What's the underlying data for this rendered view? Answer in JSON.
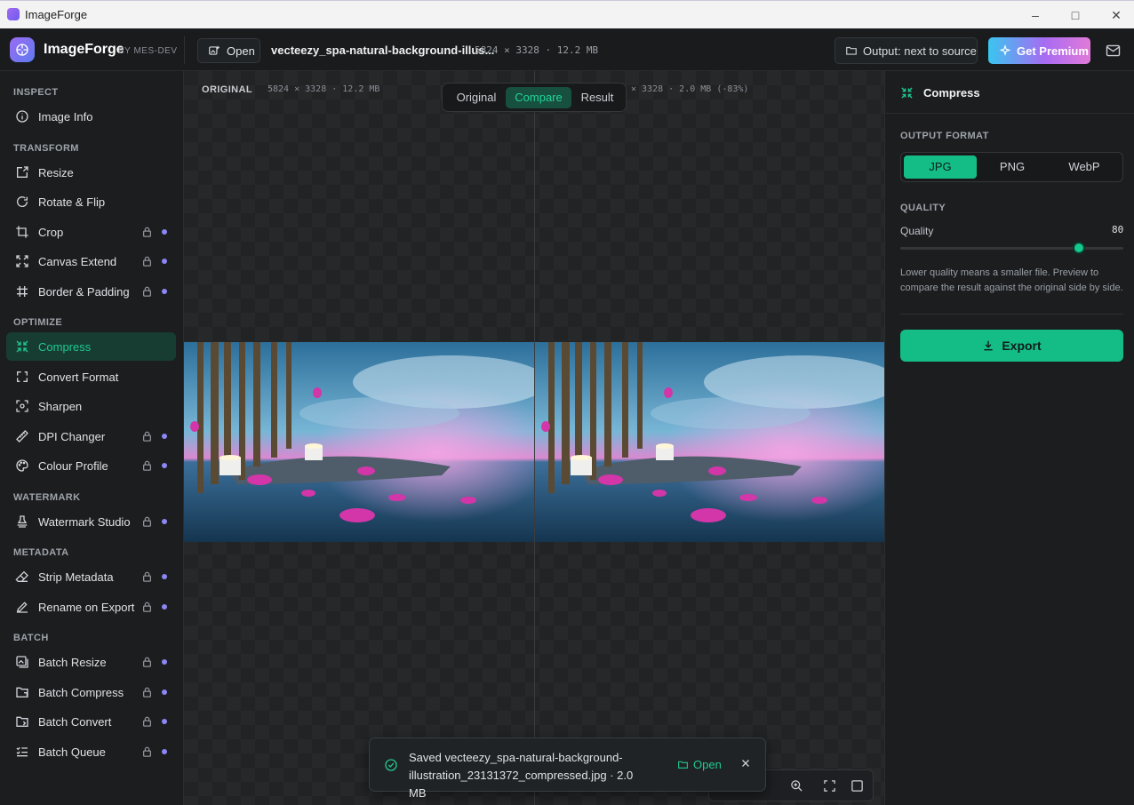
{
  "window": {
    "title": "ImageForge"
  },
  "header": {
    "brand": "ImageForge",
    "brand_by": "BY MES-DEV",
    "open_label": "Open",
    "file_name": "vecteezy_spa-natural-background-illus...",
    "file_meta": "5824 × 3328 · 12.2 MB",
    "output_label": "Output: next to source",
    "premium_label": "Get Premium"
  },
  "sidebar": {
    "sections": [
      {
        "title": "INSPECT",
        "items": [
          {
            "label": "Image Info",
            "icon": "info-icon",
            "locked": false
          }
        ]
      },
      {
        "title": "TRANSFORM",
        "items": [
          {
            "label": "Resize",
            "icon": "resize-icon",
            "locked": false
          },
          {
            "label": "Rotate & Flip",
            "icon": "rotate-icon",
            "locked": false
          },
          {
            "label": "Crop",
            "icon": "crop-icon",
            "locked": true
          },
          {
            "label": "Canvas Extend",
            "icon": "expand-icon",
            "locked": true
          },
          {
            "label": "Border & Padding",
            "icon": "hash-icon",
            "locked": true
          }
        ]
      },
      {
        "title": "OPTIMIZE",
        "items": [
          {
            "label": "Compress",
            "icon": "compress-icon",
            "locked": false,
            "active": true
          },
          {
            "label": "Convert Format",
            "icon": "convert-icon",
            "locked": false
          },
          {
            "label": "Sharpen",
            "icon": "sharpen-icon",
            "locked": false
          },
          {
            "label": "DPI Changer",
            "icon": "ruler-icon",
            "locked": true
          },
          {
            "label": "Colour Profile",
            "icon": "palette-icon",
            "locked": true
          }
        ]
      },
      {
        "title": "WATERMARK",
        "items": [
          {
            "label": "Watermark Studio",
            "icon": "stamp-icon",
            "locked": true
          }
        ]
      },
      {
        "title": "METADATA",
        "items": [
          {
            "label": "Strip Metadata",
            "icon": "eraser-icon",
            "locked": true
          },
          {
            "label": "Rename on Export",
            "icon": "pen-icon",
            "locked": true
          }
        ]
      },
      {
        "title": "BATCH",
        "items": [
          {
            "label": "Batch Resize",
            "icon": "images-icon",
            "locked": true
          },
          {
            "label": "Batch Compress",
            "icon": "folder-compress-icon",
            "locked": true
          },
          {
            "label": "Batch Convert",
            "icon": "folder-convert-icon",
            "locked": true
          },
          {
            "label": "Batch Queue",
            "icon": "list-check-icon",
            "locked": true
          }
        ]
      }
    ]
  },
  "canvas": {
    "original_label": "ORIGINAL",
    "original_meta": "5824 × 3328 · 12.2 MB",
    "result_meta": "× 3328 · 2.0 MB (-83%)",
    "view_modes": [
      "Original",
      "Compare",
      "Result"
    ],
    "active_view": "Compare"
  },
  "toast": {
    "message_line1": "Saved vecteezy_spa-natural-background-",
    "message_line2": "illustration_23131372_compressed.jpg · 2.0 MB",
    "open_label": "Open"
  },
  "zoombar": {
    "partial_text": "t"
  },
  "panel": {
    "title": "Compress",
    "output_format_label": "OUTPUT FORMAT",
    "formats": [
      "JPG",
      "PNG",
      "WebP"
    ],
    "selected_format": "JPG",
    "quality_section": "QUALITY",
    "quality_label": "Quality",
    "quality_value": "80",
    "quality_fraction": 0.8,
    "help_text": "Lower quality means a smaller file. Preview to compare the result against the original side by side.",
    "export_label": "Export"
  },
  "colors": {
    "accent": "#15bd86",
    "premium_start": "#39c6f0",
    "premium_end": "#e27ad8",
    "lock_dot": "#8c87f5"
  }
}
